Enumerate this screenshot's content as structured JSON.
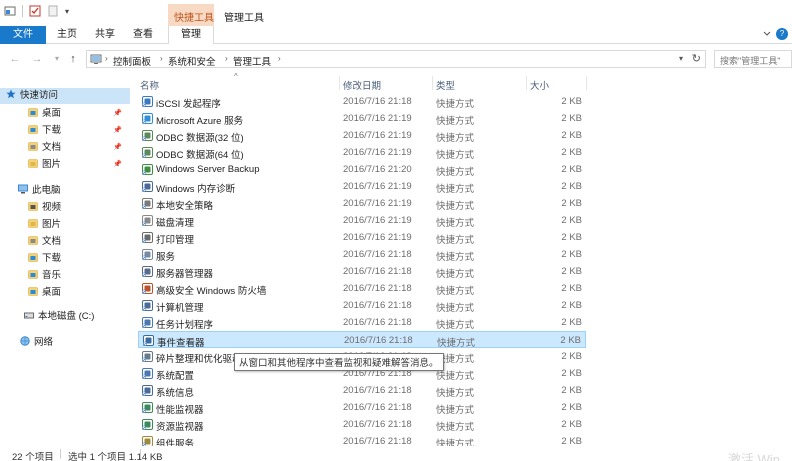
{
  "ribbon": {
    "context_group": "快捷工具",
    "window_title": "管理工具",
    "tabs": [
      "文件",
      "主页",
      "共享",
      "查看",
      "管理"
    ],
    "help": "?"
  },
  "address": {
    "crumbs": [
      "控制面板",
      "系统和安全",
      "管理工具"
    ],
    "search_placeholder": "搜索\"管理工具\""
  },
  "sidebar": {
    "items": [
      {
        "label": "快速访问",
        "icon": "star-icon",
        "pinned": false,
        "color": "#1e73c8"
      },
      {
        "label": "桌面",
        "icon": "desktop-folder-icon",
        "pinned": true,
        "color": "#2a8bd6"
      },
      {
        "label": "下载",
        "icon": "download-folder-icon",
        "pinned": true,
        "color": "#2a8bd6"
      },
      {
        "label": "文档",
        "icon": "documents-folder-icon",
        "pinned": true,
        "color": "#8a8a8a"
      },
      {
        "label": "图片",
        "icon": "pictures-folder-icon",
        "pinned": true,
        "color": "#e0b84a"
      },
      {
        "label": "此电脑",
        "icon": "computer-icon",
        "pinned": false,
        "color": "#3a8ad2"
      },
      {
        "label": "视频",
        "icon": "videos-folder-icon",
        "pinned": false,
        "color": "#555"
      },
      {
        "label": "图片",
        "icon": "pictures-folder-icon",
        "pinned": false,
        "color": "#e0b84a"
      },
      {
        "label": "文档",
        "icon": "documents-folder-icon",
        "pinned": false,
        "color": "#8a8a8a"
      },
      {
        "label": "下载",
        "icon": "download-folder-icon",
        "pinned": false,
        "color": "#2a8bd6"
      },
      {
        "label": "音乐",
        "icon": "music-folder-icon",
        "pinned": false,
        "color": "#2a8bd6"
      },
      {
        "label": "桌面",
        "icon": "desktop-folder-icon",
        "pinned": false,
        "color": "#2a8bd6"
      },
      {
        "label": "本地磁盘 (C:)",
        "icon": "drive-icon",
        "pinned": false,
        "color": "#6a6a6a"
      },
      {
        "label": "网络",
        "icon": "network-icon",
        "pinned": false,
        "color": "#3a8ad2"
      }
    ]
  },
  "columns": {
    "name": "名称",
    "date": "修改日期",
    "type": "类型",
    "size": "大小"
  },
  "files": [
    {
      "name": "iSCSI 发起程序",
      "date": "2016/7/16 21:18",
      "type": "快捷方式",
      "size": "2 KB",
      "icon": "iscsi-icon",
      "color": "#3a7ac0"
    },
    {
      "name": "Microsoft Azure 服务",
      "date": "2016/7/16 21:19",
      "type": "快捷方式",
      "size": "2 KB",
      "icon": "azure-icon",
      "color": "#2f8fd8"
    },
    {
      "name": "ODBC 数据源(32 位)",
      "date": "2016/7/16 21:19",
      "type": "快捷方式",
      "size": "2 KB",
      "icon": "odbc-icon",
      "color": "#5a8a5a"
    },
    {
      "name": "ODBC 数据源(64 位)",
      "date": "2016/7/16 21:19",
      "type": "快捷方式",
      "size": "2 KB",
      "icon": "odbc-icon",
      "color": "#5a8a5a"
    },
    {
      "name": "Windows Server Backup",
      "date": "2016/7/16 21:20",
      "type": "快捷方式",
      "size": "2 KB",
      "icon": "backup-icon",
      "color": "#3e8e3e"
    },
    {
      "name": "Windows 内存诊断",
      "date": "2016/7/16 21:19",
      "type": "快捷方式",
      "size": "2 KB",
      "icon": "memory-icon",
      "color": "#4a6a9a"
    },
    {
      "name": "本地安全策略",
      "date": "2016/7/16 21:19",
      "type": "快捷方式",
      "size": "2 KB",
      "icon": "security-policy-icon",
      "color": "#7a7a7a"
    },
    {
      "name": "磁盘清理",
      "date": "2016/7/16 21:19",
      "type": "快捷方式",
      "size": "2 KB",
      "icon": "disk-cleanup-icon",
      "color": "#8a8a8a"
    },
    {
      "name": "打印管理",
      "date": "2016/7/16 21:19",
      "type": "快捷方式",
      "size": "2 KB",
      "icon": "printer-icon",
      "color": "#6a6a6a"
    },
    {
      "name": "服务",
      "date": "2016/7/16 21:18",
      "type": "快捷方式",
      "size": "2 KB",
      "icon": "services-gear-icon",
      "color": "#7a8aa0"
    },
    {
      "name": "服务器管理器",
      "date": "2016/7/16 21:18",
      "type": "快捷方式",
      "size": "2 KB",
      "icon": "server-manager-icon",
      "color": "#5a6a8a"
    },
    {
      "name": "高级安全 Windows 防火墙",
      "date": "2016/7/16 21:18",
      "type": "快捷方式",
      "size": "2 KB",
      "icon": "firewall-icon",
      "color": "#c0502a"
    },
    {
      "name": "计算机管理",
      "date": "2016/7/16 21:18",
      "type": "快捷方式",
      "size": "2 KB",
      "icon": "computer-management-icon",
      "color": "#4a6a9a"
    },
    {
      "name": "任务计划程序",
      "date": "2016/7/16 21:18",
      "type": "快捷方式",
      "size": "2 KB",
      "icon": "task-scheduler-icon",
      "color": "#4a7ab0"
    },
    {
      "name": "事件查看器",
      "date": "2016/7/16 21:18",
      "type": "快捷方式",
      "size": "2 KB",
      "icon": "event-viewer-icon",
      "color": "#3a6aa0"
    },
    {
      "name": "碎片整理和优化驱动器",
      "date": "2016/7/16 21:18",
      "type": "快捷方式",
      "size": "2 KB",
      "icon": "defrag-icon",
      "color": "#6a7a8a"
    },
    {
      "name": "系统配置",
      "date": "2016/7/16 21:18",
      "type": "快捷方式",
      "size": "2 KB",
      "icon": "system-config-icon",
      "color": "#4a7ab0"
    },
    {
      "name": "系统信息",
      "date": "2016/7/16 21:18",
      "type": "快捷方式",
      "size": "2 KB",
      "icon": "system-info-icon",
      "color": "#4a6a9a"
    },
    {
      "name": "性能监视器",
      "date": "2016/7/16 21:18",
      "type": "快捷方式",
      "size": "2 KB",
      "icon": "performance-icon",
      "color": "#3a8a5a"
    },
    {
      "name": "资源监视器",
      "date": "2016/7/16 21:18",
      "type": "快捷方式",
      "size": "2 KB",
      "icon": "resource-monitor-icon",
      "color": "#3a8a5a"
    },
    {
      "name": "组件服务",
      "date": "2016/7/16 21:18",
      "type": "快捷方式",
      "size": "2 KB",
      "icon": "component-services-icon",
      "color": "#a08a3a"
    }
  ],
  "selected_index": 14,
  "tooltip": "从窗口和其他程序中查看监视和疑难解答消息。",
  "status": {
    "count": "22 个项目",
    "selection": "选中 1 个项目  1.14 KB"
  },
  "watermark": "激活 Win",
  "colors": {
    "accent": "#1979ca",
    "selected_bg": "#cce8ff",
    "context_tab": "#f8d9c4"
  }
}
